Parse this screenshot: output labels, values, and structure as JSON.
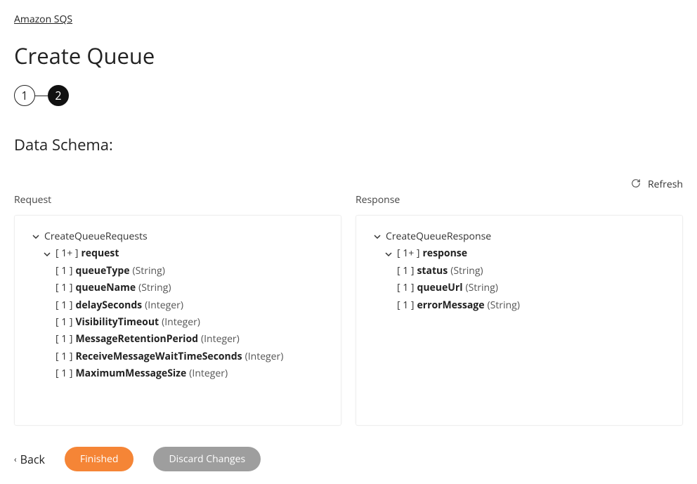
{
  "breadcrumb": {
    "label": "Amazon SQS"
  },
  "page_title": "Create Queue",
  "steps": {
    "step1": "1",
    "step2": "2"
  },
  "section_title": "Data Schema:",
  "refresh_label": "Refresh",
  "request": {
    "label": "Request",
    "root": "CreateQueueRequests",
    "node_cardinality": "[ 1+ ]",
    "node_name": "request",
    "fields": [
      {
        "cardinality": "[ 1 ]",
        "name": "queueType",
        "type": "(String)"
      },
      {
        "cardinality": "[ 1 ]",
        "name": "queueName",
        "type": "(String)"
      },
      {
        "cardinality": "[ 1 ]",
        "name": "delaySeconds",
        "type": "(Integer)"
      },
      {
        "cardinality": "[ 1 ]",
        "name": "VisibilityTimeout",
        "type": "(Integer)"
      },
      {
        "cardinality": "[ 1 ]",
        "name": "MessageRetentionPeriod",
        "type": "(Integer)"
      },
      {
        "cardinality": "[ 1 ]",
        "name": "ReceiveMessageWaitTimeSeconds",
        "type": "(Integer)"
      },
      {
        "cardinality": "[ 1 ]",
        "name": "MaximumMessageSize",
        "type": "(Integer)"
      }
    ]
  },
  "response": {
    "label": "Response",
    "root": "CreateQueueResponse",
    "node_cardinality": "[ 1+ ]",
    "node_name": "response",
    "fields": [
      {
        "cardinality": "[ 1 ]",
        "name": "status",
        "type": "(String)"
      },
      {
        "cardinality": "[ 1 ]",
        "name": "queueUrl",
        "type": "(String)"
      },
      {
        "cardinality": "[ 1 ]",
        "name": "errorMessage",
        "type": "(String)"
      }
    ]
  },
  "footer": {
    "back": "Back",
    "finished": "Finished",
    "discard": "Discard Changes"
  }
}
